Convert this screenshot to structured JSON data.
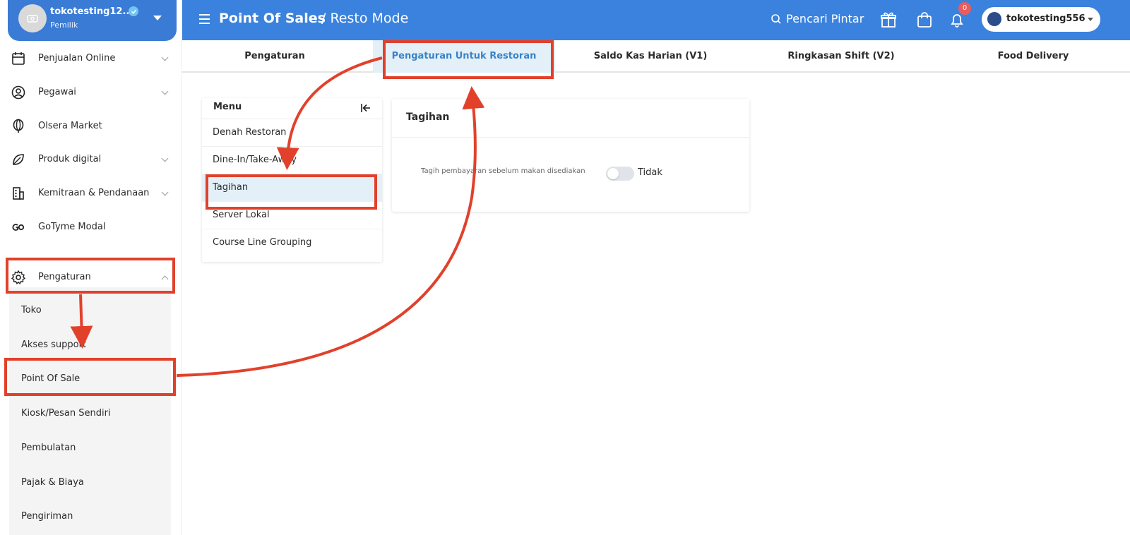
{
  "sidebar": {
    "user_name": "tokotesting12...",
    "user_role": "Pemilik",
    "items": [
      {
        "label": "Penjualan Online"
      },
      {
        "label": "Pegawai"
      },
      {
        "label": "Olsera Market"
      },
      {
        "label": "Produk digital"
      },
      {
        "label": "Kemitraan & Pendanaan"
      },
      {
        "label": "GoTyme Modal"
      },
      {
        "label": "Pengaturan"
      }
    ],
    "sub_items": [
      {
        "label": "Toko"
      },
      {
        "label": "Akses support"
      },
      {
        "label": "Point Of Sale"
      },
      {
        "label": "Kiosk/Pesan Sendiri"
      },
      {
        "label": "Pembulatan"
      },
      {
        "label": "Pajak & Biaya"
      },
      {
        "label": "Pengiriman"
      }
    ]
  },
  "header": {
    "title": "Point Of Sales",
    "subtitle": "/ Resto Mode",
    "smart_search": "Pencari Pintar",
    "notification_count": "0",
    "store_name": "tokotesting556"
  },
  "tabs": [
    {
      "label": "Pengaturan"
    },
    {
      "label": "Pengaturan Untuk Restoran"
    },
    {
      "label": "Saldo Kas Harian (V1)"
    },
    {
      "label": "Ringkasan Shift (V2)"
    },
    {
      "label": "Food Delivery"
    }
  ],
  "menu": {
    "title": "Menu",
    "items": [
      {
        "label": "Denah Restoran"
      },
      {
        "label": "Dine-In/Take-Away"
      },
      {
        "label": "Tagihan"
      },
      {
        "label": "Server Lokal"
      },
      {
        "label": "Course Line Grouping"
      }
    ]
  },
  "card": {
    "title": "Tagihan",
    "field_label": "Tagih pembayaran sebelum makan disediakan",
    "toggle_value": "Tidak"
  },
  "colors": {
    "primary": "#3a82dd",
    "annotation": "#e1412b",
    "active_tab_bg": "#e3f0f8"
  }
}
